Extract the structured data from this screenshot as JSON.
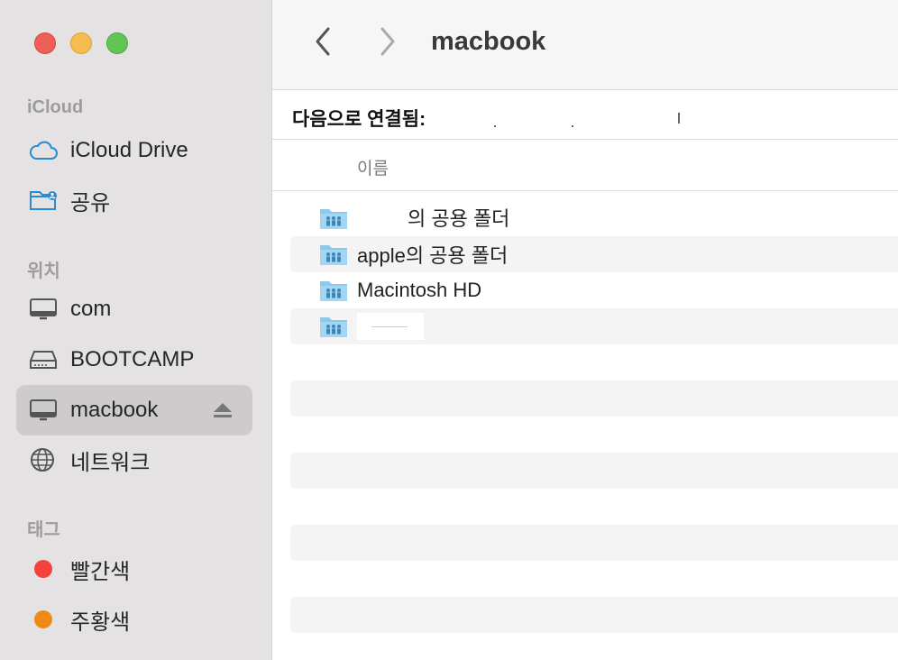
{
  "window": {
    "title": "macbook",
    "controls": [
      "close",
      "minimize",
      "maximize"
    ]
  },
  "toolbar": {
    "back_icon": "chevron-left-icon",
    "forward_icon": "chevron-right-icon"
  },
  "sidebar": {
    "sections": [
      {
        "title": "iCloud",
        "items": [
          {
            "label": "iCloud Drive",
            "icon": "cloud-icon"
          },
          {
            "label": "공유",
            "icon": "shared-folder-icon"
          }
        ]
      },
      {
        "title": "위치",
        "items": [
          {
            "label": "com",
            "icon": "display-icon"
          },
          {
            "label": "BOOTCAMP",
            "icon": "drive-icon"
          },
          {
            "label": "macbook",
            "icon": "display-icon",
            "selected": true,
            "eject_icon": "eject-icon"
          },
          {
            "label": "네트워크",
            "icon": "globe-icon"
          }
        ]
      },
      {
        "title": "태그",
        "items": [
          {
            "label": "빨간색",
            "color": "#f4413b"
          },
          {
            "label": "주황색",
            "color": "#f08a16"
          }
        ]
      }
    ]
  },
  "connection": {
    "label": "다음으로 연결됨:"
  },
  "list": {
    "column_name": "이름",
    "rows": [
      {
        "label_suffix": "의 공용 폴더",
        "redacted_prefix": true,
        "icon": "shared-folder-icon"
      },
      {
        "label": "apple의 공용 폴더",
        "icon": "shared-folder-icon"
      },
      {
        "label": "Macintosh HD",
        "icon": "shared-folder-icon"
      },
      {
        "label": "",
        "redacted": true,
        "icon": "shared-folder-icon"
      }
    ]
  },
  "colors": {
    "sidebar_bg": "#e4e2e3",
    "selected_bg": "#cdcbcc",
    "folder_blue": "#8ec9ec"
  }
}
